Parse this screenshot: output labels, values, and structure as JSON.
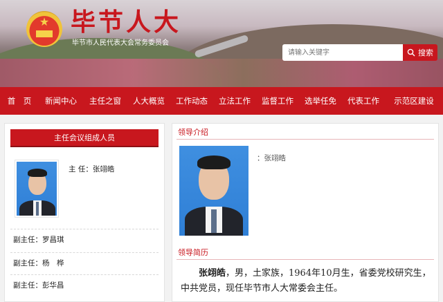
{
  "header": {
    "title": "毕节人大",
    "subtitle": "毕节市人民代表大会常务委员会",
    "search_placeholder": "请输入关键字",
    "search_button": "搜索"
  },
  "nav": {
    "items": [
      "首　页",
      "新闻中心",
      "主任之窗",
      "人大概览",
      "工作动态",
      "立法工作",
      "监督工作",
      "选举任免",
      "代表工作",
      "示范区建设"
    ]
  },
  "sidebar": {
    "heading": "主任会议组成人员",
    "chair": {
      "role": "主  任：",
      "name": "张翊皓"
    },
    "vice": [
      {
        "role": "副主任：",
        "name": "罗昌琪"
      },
      {
        "role": "副主任：",
        "name": "杨　桦"
      },
      {
        "role": "副主任：",
        "name": "彭华昌"
      }
    ]
  },
  "main": {
    "intro_title": "领导介绍",
    "name_prefix": "：",
    "name": "张翊皓",
    "resume_title": "领导简历",
    "bio_name": "张翊皓",
    "bio_text": "，男，土家族，1964年10月生，省委党校研究生，中共党员，现任毕节市人大常委会主任。"
  },
  "colors": {
    "brand_red": "#c8171e",
    "photo_bg": "#2f7fd6"
  }
}
